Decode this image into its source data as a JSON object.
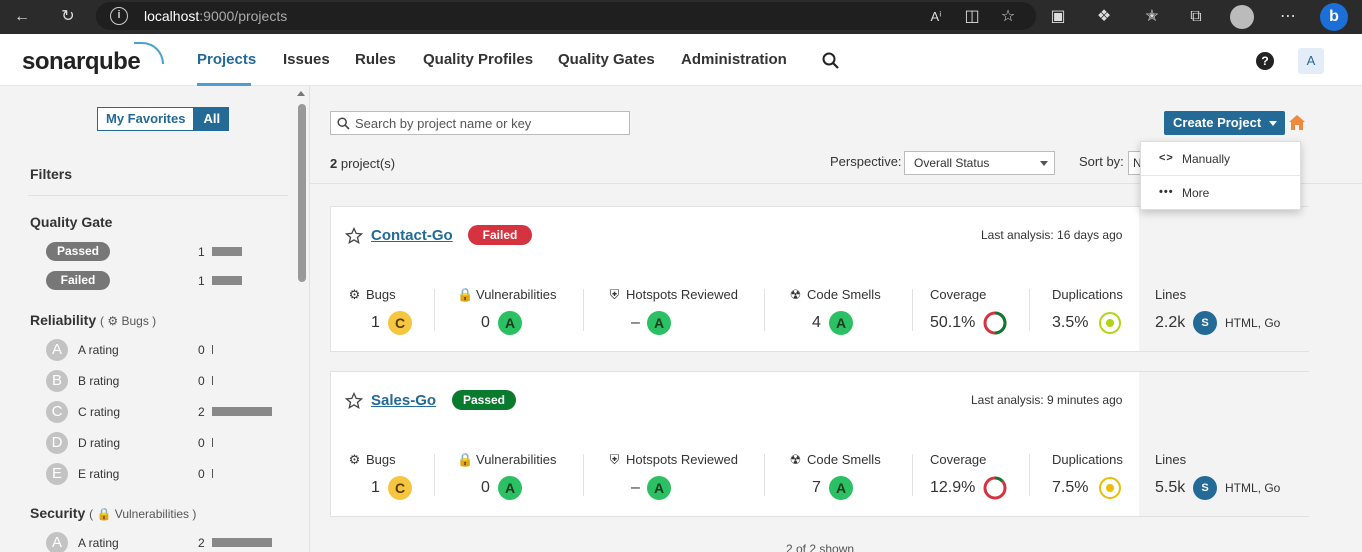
{
  "browser": {
    "url_host": "localhost",
    "url_rest": ":9000/projects"
  },
  "header": {
    "logo": "sonarqube",
    "nav": [
      "Projects",
      "Issues",
      "Rules",
      "Quality Profiles",
      "Quality Gates",
      "Administration"
    ],
    "help": "?",
    "user_initial": "A"
  },
  "sidebar": {
    "my_favorites": "My Favorites",
    "all": "All",
    "filters_title": "Filters",
    "quality_gate": {
      "title": "Quality Gate",
      "items": [
        {
          "label": "Passed",
          "count": "1",
          "fraction": 1.0
        },
        {
          "label": "Failed",
          "count": "1",
          "fraction": 1.0
        }
      ]
    },
    "reliability": {
      "title": "Reliability",
      "sub": "Bugs",
      "items": [
        {
          "grade": "A",
          "label": "A rating",
          "count": "0",
          "fraction": 0
        },
        {
          "grade": "B",
          "label": "B rating",
          "count": "0",
          "fraction": 0
        },
        {
          "grade": "C",
          "label": "C rating",
          "count": "2",
          "fraction": 1.0
        },
        {
          "grade": "D",
          "label": "D rating",
          "count": "0",
          "fraction": 0
        },
        {
          "grade": "E",
          "label": "E rating",
          "count": "0",
          "fraction": 0
        }
      ]
    },
    "security": {
      "title": "Security",
      "sub": "Vulnerabilities",
      "items": [
        {
          "grade": "A",
          "label": "A rating",
          "count": "2",
          "fraction": 1.0
        }
      ]
    }
  },
  "main": {
    "search_placeholder": "Search by project name or key",
    "project_count": "2",
    "project_count_suffix": " project(s)",
    "create_project": "Create Project",
    "perspective_label": "Perspective:",
    "perspective_value": "Overall Status",
    "sort_label": "Sort by:",
    "sort_value": "N",
    "dropdown": [
      {
        "icon": "<>",
        "label": "Manually"
      },
      {
        "icon": "•••",
        "label": "More"
      }
    ],
    "shown": "2 of 2 shown"
  },
  "metric_labels": {
    "bugs": "Bugs",
    "vulnerabilities": "Vulnerabilities",
    "hotspots": "Hotspots Reviewed",
    "code_smells": "Code Smells",
    "coverage": "Coverage",
    "duplications": "Duplications",
    "lines": "Lines"
  },
  "projects": [
    {
      "name": "Contact-Go",
      "status": "Failed",
      "status_color": "#d4333f",
      "last_analysis": "Last analysis: 16 days ago",
      "bugs": "1",
      "bugs_grade": "C",
      "vulnerabilities": "0",
      "vulnerabilities_grade": "A",
      "hotspots": "–",
      "hotspots_grade": "A",
      "code_smells": "4",
      "code_smells_grade": "A",
      "coverage": "50.1%",
      "coverage_value": 50.1,
      "duplications": "3.5%",
      "duplications_color": "#b0d513",
      "lines": "2.2k",
      "lang_badge": "S",
      "languages": "HTML, Go"
    },
    {
      "name": "Sales-Go",
      "status": "Passed",
      "status_color": "#0a7a2f",
      "last_analysis": "Last analysis: 9 minutes ago",
      "bugs": "1",
      "bugs_grade": "C",
      "vulnerabilities": "0",
      "vulnerabilities_grade": "A",
      "hotspots": "–",
      "hotspots_grade": "A",
      "code_smells": "7",
      "code_smells_grade": "A",
      "coverage": "12.9%",
      "coverage_value": 12.9,
      "duplications": "7.5%",
      "duplications_color": "#eabe06",
      "lines": "5.5k",
      "lang_badge": "S",
      "languages": "HTML, Go"
    }
  ],
  "colors": {
    "accent": "#236a97",
    "grade_a": "#2bc063",
    "grade_c": "#f6c640",
    "coverage_good": "#0a7a2f",
    "coverage_bad": "#d4333f"
  }
}
